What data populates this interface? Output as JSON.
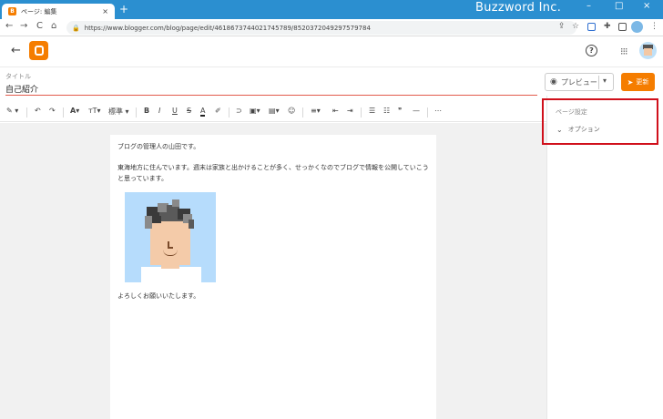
{
  "browser": {
    "tab_title": "ページ: 編集",
    "tab_close": "×",
    "new_tab": "+",
    "brand": "Buzzword Inc.",
    "window_controls": [
      "–",
      "□",
      "×"
    ],
    "nav": {
      "back": "←",
      "forward": "→",
      "reload": "C",
      "home": "⌂"
    },
    "url": "https://www.blogger.com/blog/page/edit/4618673744021745789/8520372049297579784",
    "icons": [
      "share-icon",
      "star-icon",
      "extension-icon",
      "puzzle-icon",
      "sidepanel-icon",
      "profile-icon",
      "menu-icon"
    ]
  },
  "app": {
    "back": "←",
    "help": "?",
    "apps_grid": "⋮⋮⋮"
  },
  "editor": {
    "title_label": "タイトル",
    "title_value": "自己紹介",
    "preview_label": "プレビュー",
    "update_label": "更新",
    "toolbar": {
      "pen": "✎",
      "undo": "↶",
      "redo": "↷",
      "font": "A",
      "font_size": "ᴛT",
      "paragraph": "標準",
      "bold": "B",
      "italic": "I",
      "underline": "U",
      "strike": "S",
      "text_color": "A",
      "highlight": "✐",
      "link": "⊃",
      "image": "▣",
      "video": "▤",
      "emoji": "☺",
      "align": "≡",
      "indent_less": "⇤",
      "indent_more": "⇥",
      "bullet_list": "☰",
      "number_list": "☷",
      "quote": "❞",
      "divider": "—",
      "more": "⋯"
    },
    "paragraphs": [
      "ブログの管理人の山田です。",
      "東海地方に住んでいます。週末は家族と出かけることが多く、せっかくなのでブログで情報を公開していこうと思っています。",
      "よろしくお願いいたします。"
    ]
  },
  "side_panel": {
    "title": "ページ設定",
    "option": "オプション"
  },
  "colors": {
    "chrome_blue": "#2b8fd0",
    "brand_orange": "#f57d00",
    "highlight_red": "#d0101b"
  }
}
